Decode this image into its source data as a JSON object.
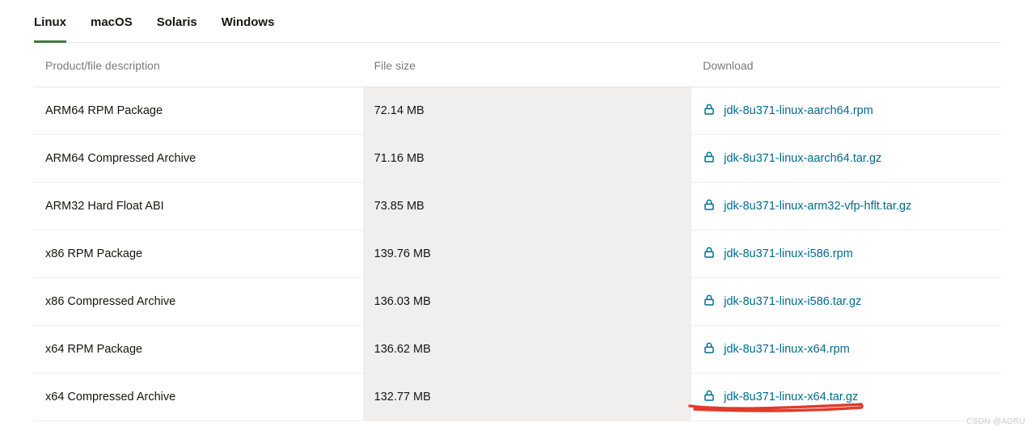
{
  "tabs": {
    "linux": "Linux",
    "macos": "macOS",
    "solaris": "Solaris",
    "windows": "Windows"
  },
  "headers": {
    "description": "Product/file description",
    "size": "File size",
    "download": "Download"
  },
  "rows": [
    {
      "desc": "ARM64 RPM Package",
      "size": "72.14 MB",
      "file": "jdk-8u371-linux-aarch64.rpm"
    },
    {
      "desc": "ARM64 Compressed Archive",
      "size": "71.16 MB",
      "file": "jdk-8u371-linux-aarch64.tar.gz"
    },
    {
      "desc": "ARM32 Hard Float ABI",
      "size": "73.85 MB",
      "file": "jdk-8u371-linux-arm32-vfp-hflt.tar.gz"
    },
    {
      "desc": "x86 RPM Package",
      "size": "139.76 MB",
      "file": "jdk-8u371-linux-i586.rpm"
    },
    {
      "desc": "x86 Compressed Archive",
      "size": "136.03 MB",
      "file": "jdk-8u371-linux-i586.tar.gz"
    },
    {
      "desc": "x64 RPM Package",
      "size": "136.62 MB",
      "file": "jdk-8u371-linux-x64.rpm"
    },
    {
      "desc": "x64 Compressed Archive",
      "size": "132.77 MB",
      "file": "jdk-8u371-linux-x64.tar.gz"
    }
  ],
  "watermark": "CSDN @ADRU",
  "colors": {
    "link": "#006b8f",
    "tabActive": "#3a7a3a",
    "annotation": "#e03b2a"
  }
}
